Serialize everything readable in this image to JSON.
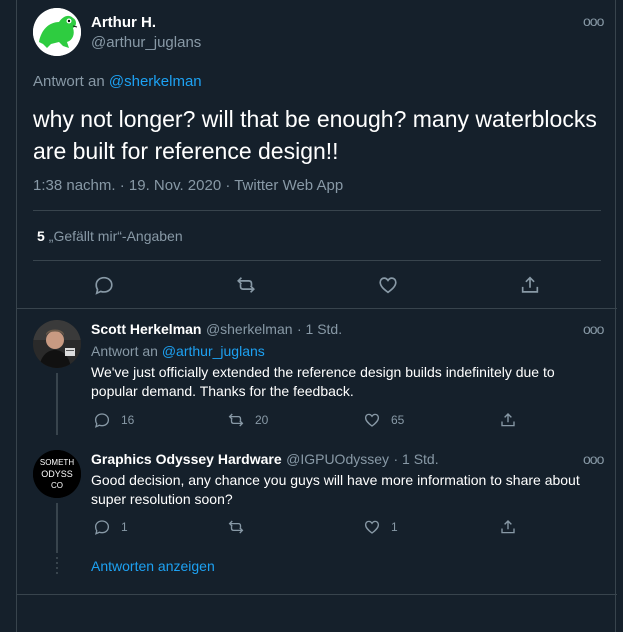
{
  "main_tweet": {
    "author_name": "Arthur H.",
    "author_handle": "@arthur_juglans",
    "more_label": "ooo",
    "reply_prefix": "Antwort an",
    "reply_handle": "@sherkelman",
    "text": "why not longer? will that be enough? many waterblocks are built for reference design!!",
    "meta": "1:38 nachm. · 19. Nov. 2020 · Twitter Web App",
    "likes_count": "5",
    "likes_label": "„Gefällt mir“-Angaben",
    "actions": [
      "reply-icon",
      "retweet-icon",
      "like-icon",
      "share-icon"
    ]
  },
  "replies": [
    {
      "author_name": "Scott Herkelman",
      "author_handle": "@sherkelman",
      "time": "· 1 Std.",
      "reply_prefix": "Antwort an",
      "reply_handle": "@arthur_juglans",
      "text": "We've just officially extended the reference design builds indefinitely due to popular demand.  Thanks for the feedback.",
      "reply_count": "16",
      "retweet_count": "20",
      "like_count": "65"
    },
    {
      "author_name": "Graphics Odyssey Hardware",
      "author_handle": "@IGPUOdyssey",
      "time": "· 1 Std.",
      "avatar_text": "SOMETH ODYSS CO",
      "text": "Good decision, any chance you guys will have more information to share about super resolution soon?",
      "reply_count": "1",
      "retweet_count": "",
      "like_count": "1"
    }
  ],
  "show_replies_label": "Antworten anzeigen",
  "colors": {
    "background": "#15202b",
    "border": "#38444d",
    "secondary_text": "#8899a6",
    "accent": "#1da1f2",
    "avatar_green": "#2ecc40"
  }
}
